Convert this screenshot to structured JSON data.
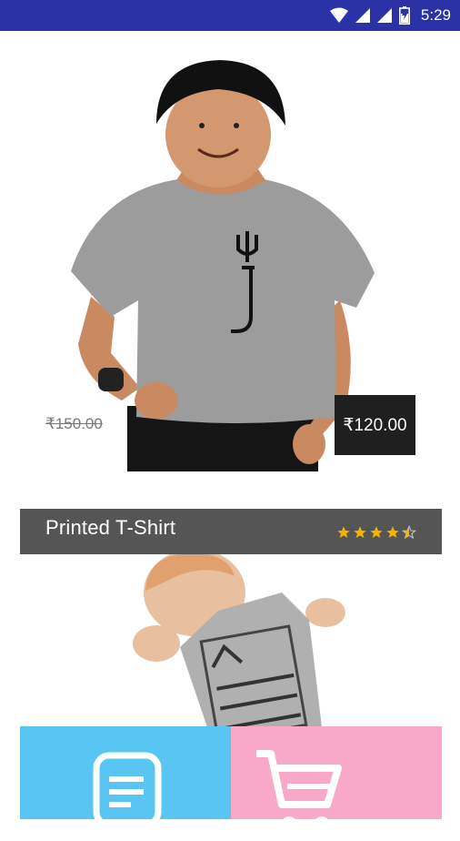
{
  "status_bar": {
    "time": "5:29",
    "icons": [
      "wifi-icon",
      "signal-icon",
      "signal-icon",
      "battery-icon"
    ],
    "background": "#2a32a6"
  },
  "product": {
    "old_price": "₹150.00",
    "new_price": "₹120.00",
    "title": "Printed T-Shirt",
    "rating": 4.5,
    "rating_max": 5
  },
  "bottom_actions": [
    {
      "icon": "note-icon",
      "color": "#58c5f2"
    },
    {
      "icon": "cart-icon",
      "color": "#f8a8c8"
    }
  ],
  "colors": {
    "title_bar": "#555555",
    "price_tag": "#1f1f1f",
    "star": "#f4b400"
  }
}
